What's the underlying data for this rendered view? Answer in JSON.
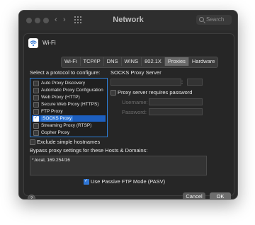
{
  "window": {
    "title": "Network",
    "search_placeholder": "Search"
  },
  "service": {
    "name": "Wi-Fi"
  },
  "tabs": [
    {
      "label": "Wi-Fi",
      "active": false
    },
    {
      "label": "TCP/IP",
      "active": false
    },
    {
      "label": "DNS",
      "active": false
    },
    {
      "label": "WINS",
      "active": false
    },
    {
      "label": "802.1X",
      "active": false
    },
    {
      "label": "Proxies",
      "active": true
    },
    {
      "label": "Hardware",
      "active": false
    }
  ],
  "protocols": {
    "heading": "Select a protocol to configure:",
    "items": [
      {
        "label": "Auto Proxy Discovery",
        "checked": false,
        "selected": false
      },
      {
        "label": "Automatic Proxy Configuration",
        "checked": false,
        "selected": false
      },
      {
        "label": "Web Proxy (HTTP)",
        "checked": false,
        "selected": false
      },
      {
        "label": "Secure Web Proxy (HTTPS)",
        "checked": false,
        "selected": false
      },
      {
        "label": "FTP Proxy",
        "checked": false,
        "selected": false
      },
      {
        "label": "SOCKS Proxy",
        "checked": true,
        "selected": true
      },
      {
        "label": "Streaming Proxy (RTSP)",
        "checked": false,
        "selected": false
      },
      {
        "label": "Gopher Proxy",
        "checked": false,
        "selected": false
      }
    ]
  },
  "proxy_server": {
    "heading": "SOCKS Proxy Server",
    "server": "",
    "port_separator": ":",
    "port": "",
    "requires_password_label": "Proxy server requires password",
    "requires_password": false,
    "username_label": "Username:",
    "password_label": "Password:"
  },
  "exclude_simple_hostnames": {
    "label": "Exclude simple hostnames",
    "checked": false
  },
  "bypass": {
    "label": "Bypass proxy settings for these Hosts & Domains:",
    "value": "*.local, 169.254/16"
  },
  "passive_ftp": {
    "label": "Use Passive FTP Mode (PASV)",
    "checked": true
  },
  "buttons": {
    "help": "?",
    "cancel": "Cancel",
    "ok": "OK"
  }
}
